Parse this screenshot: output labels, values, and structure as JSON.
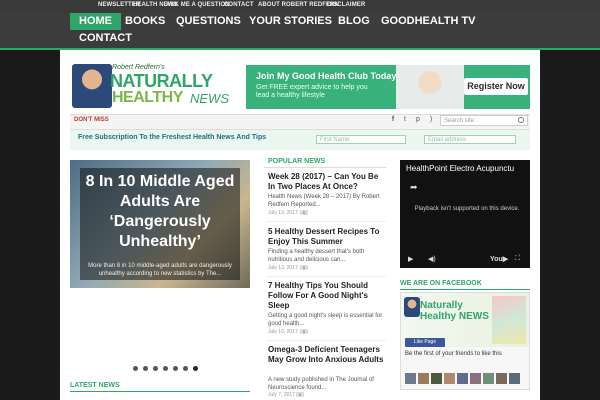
{
  "topbar": {
    "links": [
      "NEWSLETTER",
      "HEALTH NEWS",
      "ASK ME A QUESTION",
      "CONTACT",
      "ABOUT ROBERT REDFERN",
      "DISCLAIMER"
    ]
  },
  "nav": {
    "items": [
      "HOME",
      "BOOKS",
      "QUESTIONS",
      "YOUR STORIES",
      "BLOG",
      "GOODHEALTH TV",
      "CONTACT"
    ],
    "active_index": 0
  },
  "header": {
    "brand_small": "Robert Redfern's",
    "brand_line1": "NATURALLY",
    "brand_line2": "HEALTHY",
    "brand_news": "NEWS"
  },
  "banner": {
    "title": "Join My Good Health Club Today!",
    "subtitle": "Get FREE expert advice to help you lead a healthy lifestyle",
    "button_label": "Register Now"
  },
  "dont_miss": {
    "label": "DON'T MISS",
    "social_icons": [
      "facebook-icon",
      "twitter-icon",
      "pinterest-icon",
      "rss-icon"
    ],
    "search_placeholder": "Search site"
  },
  "subscription": {
    "text": "Free Subscription To the Freshest Health News And Tips",
    "first_name_placeholder": "First Name",
    "email_placeholder": "Email address"
  },
  "slider": {
    "title": "8 In 10 Middle Aged Adults Are ‘Dangerously Unhealthy’",
    "subtitle": "More than 8 in 10 middle-aged adults are dangerously unhealthy according to new statistics by The...",
    "dots": 7,
    "active_dot": 6
  },
  "sections": {
    "popular_news": "POPULAR NEWS",
    "latest_news": "LATEST NEWS",
    "facebook": "WE ARE ON FACEBOOK"
  },
  "popular_news": [
    {
      "title": "Week 28 (2017) – Can You Be In Two Places At Once?",
      "excerpt": "Health News (Week 28 – 2017) By Robert Redfern Reported...",
      "date": "July 13, 2017",
      "comments": "0"
    },
    {
      "title": "5 Healthy Dessert Recipes To Enjoy This Summer",
      "excerpt": "Finding a healthy dessert that's both nutritious and delicious can...",
      "date": "July 13, 2017",
      "comments": "0"
    },
    {
      "title": "7 Healthy Tips You Should Follow For A Good Night's Sleep",
      "excerpt": "Getting a good night's sleep is essential for good health...",
      "date": "July 10, 2017",
      "comments": "0"
    },
    {
      "title": "Omega-3 Deficient Teenagers May Grow Into Anxious Adults",
      "excerpt": "A new study published in The Journal of Neuroscience found...",
      "date": "July 7, 2017",
      "comments": "0"
    }
  ],
  "video": {
    "title": "HealthPoint Electro Acupunctu",
    "message": "Playback isn't supported on this device.",
    "controls": [
      "play-icon",
      "volume-icon",
      "youtube-icon",
      "fullscreen-icon"
    ]
  },
  "facebook": {
    "page_name_1": "Naturally",
    "page_name_2": "Healthy NEWS",
    "like_label": "Like Page",
    "friends_text": "Be the first of your friends to like this"
  },
  "colors": {
    "accent_green": "#2fa56a",
    "nav_bg": "#3c3c3c",
    "dont_miss_red": "#c0392b"
  }
}
